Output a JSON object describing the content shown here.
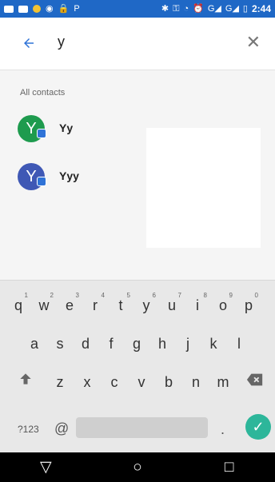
{
  "status_bar": {
    "time": "2:44",
    "icons": [
      "message-icon",
      "sim-icon",
      "app-icon",
      "settings-icon",
      "lock-icon",
      "parking-icon",
      "bluetooth-icon",
      "key-icon",
      "wifi-icon",
      "alarm-icon",
      "signal-g-icon",
      "signal-g-icon",
      "battery-icon"
    ]
  },
  "search": {
    "query": "y"
  },
  "contacts": {
    "section_title": "All contacts",
    "items": [
      {
        "initial": "Y",
        "name": "Yy",
        "color": "#1e9b4e"
      },
      {
        "initial": "Y",
        "name": "Yyy",
        "color": "#3f58b5"
      }
    ]
  },
  "keyboard": {
    "row1": [
      {
        "main": "q",
        "sub": "1"
      },
      {
        "main": "w",
        "sub": "2"
      },
      {
        "main": "e",
        "sub": "3"
      },
      {
        "main": "r",
        "sub": "4"
      },
      {
        "main": "t",
        "sub": "5"
      },
      {
        "main": "y",
        "sub": "6"
      },
      {
        "main": "u",
        "sub": "7"
      },
      {
        "main": "i",
        "sub": "8"
      },
      {
        "main": "o",
        "sub": "9"
      },
      {
        "main": "p",
        "sub": "0"
      }
    ],
    "row2": [
      "a",
      "s",
      "d",
      "f",
      "g",
      "h",
      "j",
      "k",
      "l"
    ],
    "row3": [
      "z",
      "x",
      "c",
      "v",
      "b",
      "n",
      "m"
    ],
    "symbols_label": "?123",
    "comma_label": "@",
    "period_label": ".",
    "done_icon": "check-icon"
  },
  "navbar": {
    "back_icon": "triangle-back-icon",
    "home_icon": "circle-home-icon",
    "recents_icon": "square-recents-icon"
  },
  "colors": {
    "accent": "#1f68c6",
    "done_green": "#2db69a"
  }
}
